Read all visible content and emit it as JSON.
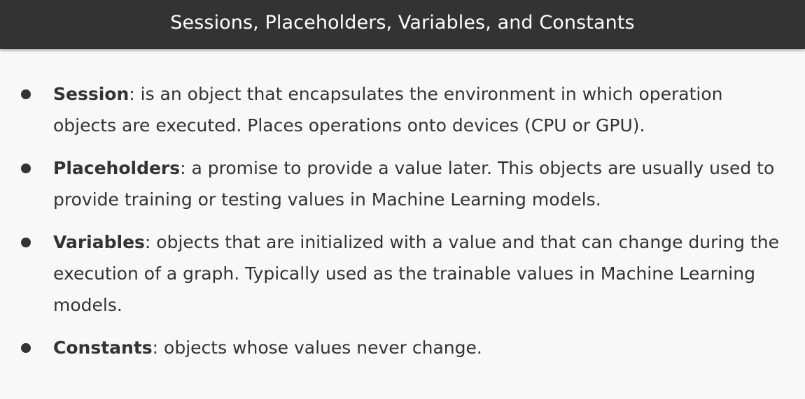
{
  "slide": {
    "title": "Sessions, Placeholders, Variables, and Constants"
  },
  "bullets": [
    {
      "term": "Session",
      "text": ": is an object that encapsulates the environment in which operation objects are executed. Places operations onto devices (CPU or GPU)."
    },
    {
      "term": "Placeholders",
      "text": ": a promise to provide a value later. This objects are usually used to provide training or testing values in Machine Learning models."
    },
    {
      "term": "Variables",
      "text": ": objects that are initialized with a value and that can change during the execution of a graph. Typically used as the trainable values in Machine Learning models."
    },
    {
      "term": "Constants",
      "text": ": objects whose values never change."
    }
  ]
}
